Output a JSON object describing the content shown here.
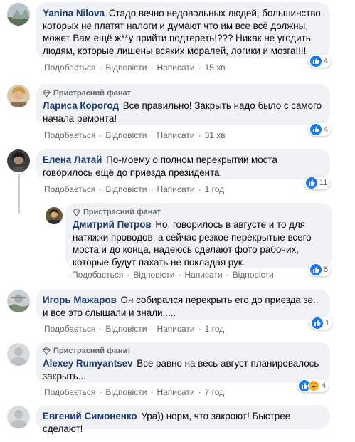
{
  "actions": {
    "like": "Подобається",
    "reply": "Відповісти",
    "write": "Написати"
  },
  "badge_label": "Пристрасний фанат",
  "comments": [
    {
      "author": "Yanina Nilova",
      "text": "Стадо вечно недовольных людей, большинство которых не платят налоги и думают что им все всё должны, может Вам ещё ж**у прийти подтереть!??? Никак не угодить людям, которые лишены всяких моралей, логики и мозга!!!!",
      "time": "15 хв",
      "reactions": "4",
      "reaction_types": [
        "like"
      ]
    },
    {
      "author": "Лариса Корогод",
      "text": "Все правильно! Закрыть надо было с самого начала ремонта!",
      "time": "31 хв",
      "reactions": "4",
      "reaction_types": [
        "like"
      ],
      "badge": true
    },
    {
      "author": "Елена Латай",
      "text": "По-моему о полном перекрытии моста говорилось ещё до приезда президента.",
      "time": "1 год",
      "reactions": "11",
      "reaction_types": [
        "like"
      ]
    },
    {
      "author": "Дмитрий Петров",
      "text": "Но, говорилось в августе и то для натяжки проводов, а сейчас резкое перекрытые всего моста и до конца, надеюсь сделают фото рабочих, которые будут пахать не покладая рук.",
      "reactions": "5",
      "reaction_types": [
        "like"
      ],
      "badge": true,
      "reply": true
    },
    {
      "author": "Игорь Мажаров",
      "text": "Он собирался перекрыть его до приезда зе.. и все это слышали и знали.....",
      "time": "1 год",
      "reactions": "1",
      "reaction_types": [
        "like"
      ]
    },
    {
      "author": "Alexey Rumyantsev",
      "text": "Все равно на весь август планировалось закрыть...",
      "time": "7 год",
      "reactions": "4",
      "reaction_types": [
        "like",
        "haha"
      ],
      "badge": true
    },
    {
      "author": "Евгений Симоненко",
      "text": "Ура)) норм, что закроют! Быстрее сделают!",
      "reaction_types": []
    }
  ],
  "colors": {
    "bubble": "#f0f2f5",
    "author": "#1d3a6e",
    "meta": "#65676b",
    "like": "#1877f2"
  }
}
